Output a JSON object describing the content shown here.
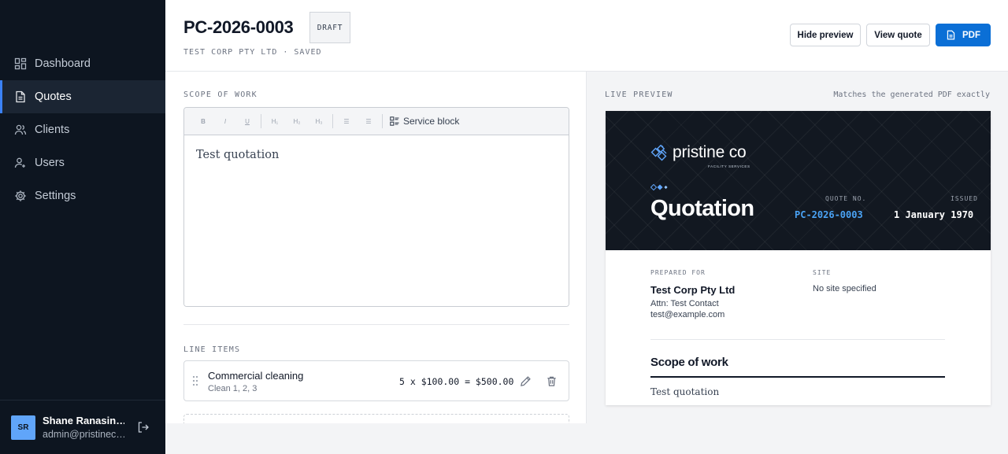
{
  "sidebar": {
    "nav": [
      {
        "label": "Dashboard",
        "icon": "dashboard-icon"
      },
      {
        "label": "Quotes",
        "icon": "document-icon",
        "active": true
      },
      {
        "label": "Clients",
        "icon": "users-icon"
      },
      {
        "label": "Users",
        "icon": "user-icon"
      },
      {
        "label": "Settings",
        "icon": "gear-icon"
      }
    ],
    "user": {
      "initials": "SR",
      "name": "Shane Ranasin…",
      "email": "admin@pristinec…"
    }
  },
  "header": {
    "title": "PC-2026-0003",
    "status": "DRAFT",
    "subtitle": "TEST CORP PTY LTD · SAVED",
    "buttons": {
      "hide_preview": "Hide preview",
      "view_quote": "View quote",
      "pdf": "PDF"
    }
  },
  "editor": {
    "scope_label": "SCOPE OF WORK",
    "toolbar": {
      "bold": "B",
      "italic": "I",
      "underline": "U",
      "h1": "H₁",
      "h2": "H₂",
      "h3": "H₃",
      "bullet_list": "☰",
      "ordered_list": "☰",
      "service_block": "Service block"
    },
    "content": "Test quotation",
    "line_items_label": "LINE ITEMS",
    "line_items": [
      {
        "name": "Commercial cleaning",
        "description": "Clean 1, 2, 3",
        "calc": "5 x $100.00 = $500.00"
      }
    ]
  },
  "preview": {
    "label": "LIVE PREVIEW",
    "note": "Matches the generated PDF exactly",
    "document": {
      "brand_name": "pristine co",
      "brand_tagline": "FACILITY SERVICES",
      "title": "Quotation",
      "quote_no_label": "QUOTE NO.",
      "quote_no": "PC-2026-0003",
      "issued_label": "ISSUED",
      "issued": "1 January 1970",
      "prepared_for_label": "PREPARED FOR",
      "client_name": "Test Corp Pty Ltd",
      "attn": "Attn: Test Contact",
      "email": "test@example.com",
      "site_label": "SITE",
      "site": "No site specified",
      "scope_heading": "Scope of work",
      "scope_text": "Test quotation"
    }
  },
  "colors": {
    "sidebar_bg": "#0d1520",
    "accent": "#0b6fd6",
    "quote_no": "#4aa3f5",
    "hero_bg": "#121821"
  }
}
